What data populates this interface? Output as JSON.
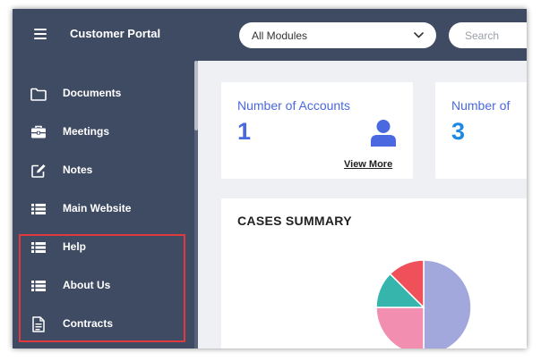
{
  "header": {
    "brand": "Customer Portal",
    "module_select": {
      "selected": "All Modules"
    },
    "search": {
      "placeholder": "Search"
    }
  },
  "sidebar": {
    "items": [
      {
        "label": "Documents",
        "icon": "folder-icon"
      },
      {
        "label": "Meetings",
        "icon": "briefcase-icon"
      },
      {
        "label": "Notes",
        "icon": "edit-note-icon"
      },
      {
        "label": "Main Website",
        "icon": "list-icon"
      },
      {
        "label": "Help",
        "icon": "list-icon"
      },
      {
        "label": "About Us",
        "icon": "list-icon"
      },
      {
        "label": "Contracts",
        "icon": "document-icon"
      }
    ],
    "highlight_color": "#e0393e"
  },
  "cards": [
    {
      "title": "Number of Accounts",
      "count": "1",
      "count_color": "#4a68e0",
      "link": "View More",
      "icon": "user-icon"
    },
    {
      "title": "Number of",
      "count": "3",
      "count_color": "#1e88e5"
    }
  ],
  "summary": {
    "title": "CASES SUMMARY",
    "chart_data": {
      "type": "pie",
      "slices": [
        {
          "value": 50,
          "color": "#a2a8dc"
        },
        {
          "value": 25,
          "color": "#f28fb0"
        },
        {
          "value": 12.5,
          "color": "#35b5ac"
        },
        {
          "value": 12.5,
          "color": "#f0505a"
        }
      ]
    }
  },
  "colors": {
    "sidebar_bg": "#3f4b63",
    "content_bg": "#eef0f4",
    "accent": "#4a68e0"
  }
}
